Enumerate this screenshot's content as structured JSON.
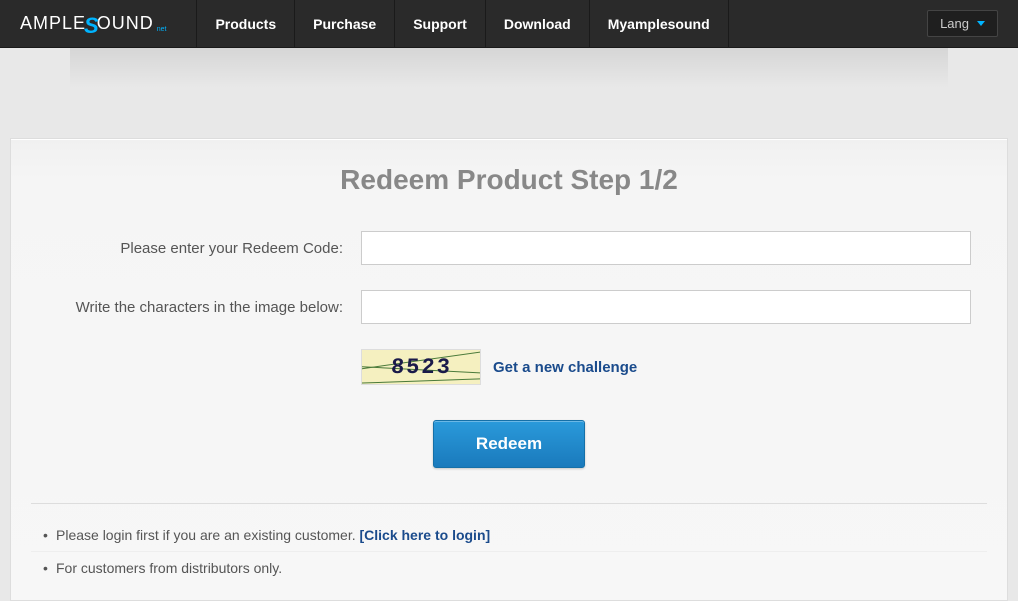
{
  "nav": {
    "logo_prefix": "AMPLE",
    "logo_suffix": "OUND",
    "logo_sub": "net",
    "items": [
      "Products",
      "Purchase",
      "Support",
      "Download",
      "Myamplesound"
    ],
    "lang_label": "Lang"
  },
  "page": {
    "title": "Redeem Product Step 1/2"
  },
  "form": {
    "redeem_label": "Please enter your Redeem Code:",
    "redeem_value": "",
    "captcha_label": "Write the characters in the image below:",
    "captcha_value": "",
    "captcha_image_text": "8523",
    "challenge_link": "Get a new challenge",
    "submit_label": "Redeem"
  },
  "notes": {
    "login_prefix": "Please login first if you are an existing customer. ",
    "login_link": "[Click here to login]",
    "distributor": "For customers from distributors only."
  }
}
